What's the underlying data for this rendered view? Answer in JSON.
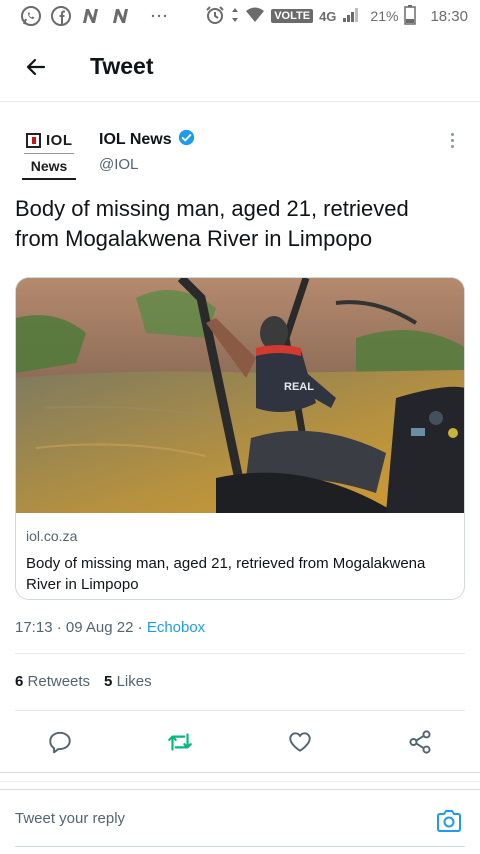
{
  "status_bar": {
    "left_icons": [
      "whatsapp-icon",
      "facebook-icon",
      "news-n-icon",
      "news-n-icon",
      "more-notifications-icon"
    ],
    "network_label": "VOLTE",
    "network_type": "4G",
    "battery": "21%",
    "time": "18:30"
  },
  "header": {
    "title": "Tweet"
  },
  "tweet": {
    "author": {
      "name": "IOL News",
      "handle": "@IOL",
      "verified": true,
      "avatar_text_top": "IOL",
      "avatar_text_bottom": "News"
    },
    "text": "Body of missing man, aged 21, retrieved from Mogalakwena River in Limpopo",
    "card": {
      "domain": "iol.co.za",
      "title": "Body of missing man, aged 21, retrieved from Mogalakwena River in Limpopo",
      "image_vest_text": "REAL"
    },
    "time": "17:13",
    "date": "09 Aug 22",
    "separator": "·",
    "source": "Echobox",
    "retweets_count": "6",
    "retweets_label": "Retweets",
    "likes_count": "5",
    "likes_label": "Likes"
  },
  "reply": {
    "placeholder": "Tweet your reply"
  },
  "colors": {
    "accent": "#1d9bf0",
    "retweet_green": "#00ba7c",
    "secondary_text": "#536471"
  }
}
